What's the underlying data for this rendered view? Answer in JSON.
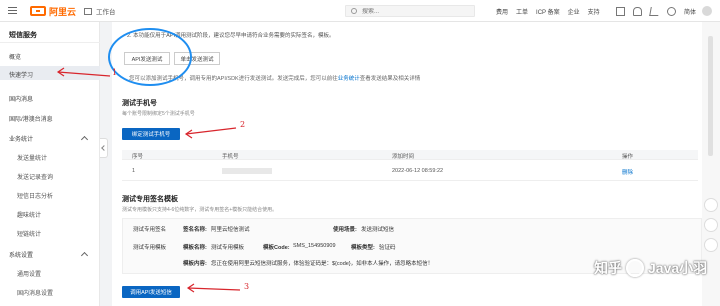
{
  "header": {
    "logo_text": "阿里云",
    "workbench": "工作台",
    "search_placeholder": "搜索...",
    "nav": [
      "费用",
      "工单",
      "ICP 备案",
      "企业",
      "支持"
    ],
    "lang": "简体"
  },
  "sidebar": {
    "title": "短信服务",
    "items": [
      {
        "label": "概览"
      },
      {
        "label": "快速学习"
      },
      {
        "label": "国内消息"
      },
      {
        "label": "国际/港澳台消息"
      },
      {
        "label": "业务统计"
      },
      {
        "label": "发送量统计"
      },
      {
        "label": "发送记录查询"
      },
      {
        "label": "短信日志分析"
      },
      {
        "label": "趣味统计"
      },
      {
        "label": "短链统计"
      },
      {
        "label": "系统设置"
      },
      {
        "label": "通用设置"
      },
      {
        "label": "国内消息设置"
      }
    ]
  },
  "main": {
    "hint_line1": "...",
    "hint_line2": "2. 本功能仅用于API调用测试阶段，建议您尽早申请符合业务需要的实际签名，模板。",
    "btn_api_test": "API发送测试",
    "btn_send_test": "单击发送测试",
    "note_text": "您可以添加测试手机号，调用专用的API/SDK进行发送测试。发送完成后，您可以前往",
    "note_link": "业务统计",
    "note_tail": "查看发送结果及相关详情",
    "section1_title": "测试手机号",
    "section1_sub": "每个账号限制绑定5个测试手机号",
    "btn_bind": "绑定测试手机号",
    "table": {
      "headers": [
        "序号",
        "手机号",
        "添加时间",
        "操作"
      ],
      "rows": [
        {
          "index": "1",
          "phone": "",
          "time": "2022-06-12 08:59:22",
          "action": "删除"
        }
      ]
    },
    "section2_title": "测试专用签名模板",
    "section2_sub": "测试专用模板只支持4-6位纯数字，测试专用签名+模板只能结合使用。",
    "sig_label": "测试专用签名",
    "sig_name_label": "签名名称:",
    "sig_name": "阿里云短信测试",
    "sig_scene_label": "使用场景:",
    "sig_scene": "发送测试短信",
    "tpl_label": "测试专用模板",
    "tpl_name_label": "模板名称:",
    "tpl_name": "测试专用模板",
    "tpl_code_label": "模板Code:",
    "tpl_code": "SMS_154950909",
    "tpl_type_label": "模板类型:",
    "tpl_type": "验证码",
    "tpl_content_label": "模板内容:",
    "tpl_content": "您正在使用阿里云短信测试服务，体验验证码是：${code}，如非本人操作，请忽略本短信！",
    "btn_call_api": "调用API发送短信"
  },
  "annotations": [
    "1",
    "2",
    "3"
  ],
  "watermark": {
    "text1": "知乎",
    "text2": "Java小羽"
  },
  "colors": {
    "brand": "#ff6a00",
    "primary": "#0a66c2",
    "annotation": "#d8262d",
    "circle": "#1f8ef0"
  }
}
